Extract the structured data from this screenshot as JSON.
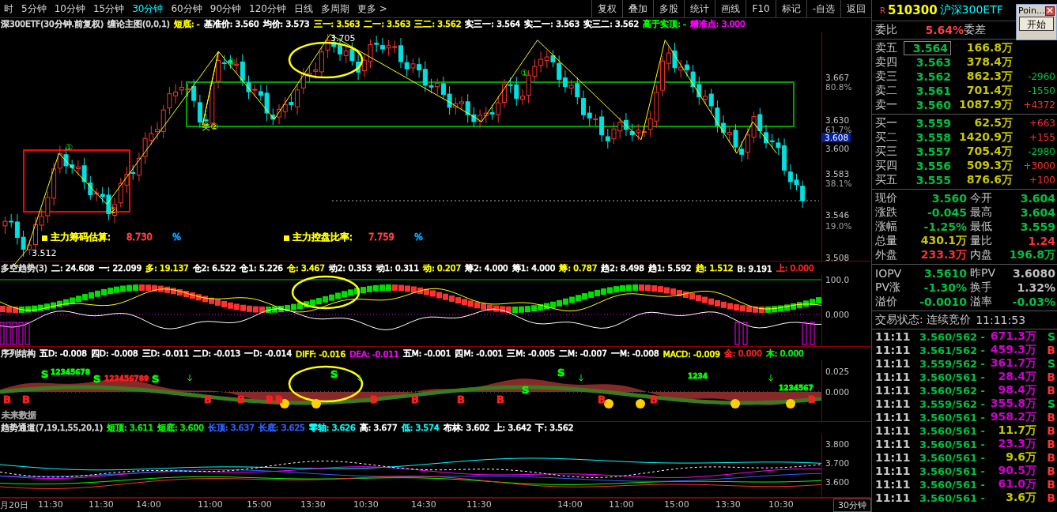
{
  "period_tabs": [
    {
      "label": "时",
      "selected": false
    },
    {
      "label": "5分钟",
      "selected": false
    },
    {
      "label": "10分钟",
      "selected": false
    },
    {
      "label": "15分钟",
      "selected": false
    },
    {
      "label": "30分钟",
      "selected": true
    },
    {
      "label": "60分钟",
      "selected": false
    },
    {
      "label": "90分钟",
      "selected": false
    },
    {
      "label": "120分钟",
      "selected": false
    },
    {
      "label": "日线",
      "selected": false
    },
    {
      "label": "多周期",
      "selected": false
    },
    {
      "label": "更多 >",
      "selected": false
    }
  ],
  "toolbar_buttons": [
    "复权",
    "叠加",
    "多股",
    "统计",
    "画线",
    "F10",
    "标记",
    "-自选",
    "返回"
  ],
  "main_chart": {
    "title": "深300ETF(30分钟.前复权)",
    "indicator": "缠论主图(0,0,1)",
    "readouts": [
      {
        "text": "短底: -",
        "color": "#ffff00"
      },
      {
        "text": "基准价: 3.560",
        "color": "#ffffff"
      },
      {
        "text": "均价: 3.573",
        "color": "#ffffff"
      },
      {
        "text": "三一: 3.563",
        "color": "#ffff00"
      },
      {
        "text": "二一: 3.563",
        "color": "#ffff00"
      },
      {
        "text": "三二: 3.562",
        "color": "#ffff00"
      },
      {
        "text": "实三一: 3.564",
        "color": "#ffffff"
      },
      {
        "text": "实二一: 3.563",
        "color": "#ffffff"
      },
      {
        "text": "实三二: 3.562",
        "color": "#ffffff"
      },
      {
        "text": "高于实顶: -",
        "color": "#00ff00"
      },
      {
        "text": "精准点: 3.000",
        "color": "#ff00ff"
      }
    ],
    "price_labels": [
      {
        "text": "3.667",
        "kind": "price"
      },
      {
        "text": "80.8%",
        "kind": "percent"
      },
      {
        "text": "3.630",
        "kind": "price"
      },
      {
        "text": "61.7%",
        "kind": "percent"
      },
      {
        "text": "3.608",
        "kind": "current"
      },
      {
        "text": "3.600",
        "kind": "price"
      },
      {
        "text": "3.583",
        "kind": "price"
      },
      {
        "text": "38.1%",
        "kind": "percent"
      },
      {
        "text": "3.546",
        "kind": "price"
      },
      {
        "text": "19.0%",
        "kind": "percent"
      },
      {
        "text": "3.508",
        "kind": "price"
      }
    ],
    "marks": [
      {
        "text": "3.705"
      },
      {
        "text": "3.512"
      },
      {
        "text": "①"
      },
      {
        "text": "②"
      },
      {
        "text": "①"
      },
      {
        "text": "类②"
      },
      {
        "text": "①"
      }
    ],
    "stats": [
      {
        "label": "主力筹码估算:",
        "value": "8.730",
        "unit": "%"
      },
      {
        "label": "主力控盘比率:",
        "value": "7.759",
        "unit": "%"
      }
    ]
  },
  "trend_panel": {
    "title": "多空趋势(3)",
    "readouts": [
      {
        "text": "二: 24.608",
        "color": "#ffffff"
      },
      {
        "text": "一: 22.099",
        "color": "#ffffff"
      },
      {
        "text": "多: 19.137",
        "color": "#ffff00"
      },
      {
        "text": "仓2: 6.522",
        "color": "#ffffff"
      },
      {
        "text": "仓1: 5.226",
        "color": "#ffffff"
      },
      {
        "text": "仓: 3.467",
        "color": "#ffff00"
      },
      {
        "text": "动2: 0.353",
        "color": "#ffffff"
      },
      {
        "text": "动1: 0.311",
        "color": "#ffffff"
      },
      {
        "text": "动: 0.207",
        "color": "#ffff00"
      },
      {
        "text": "筹2: 4.000",
        "color": "#ffffff"
      },
      {
        "text": "筹1: 4.000",
        "color": "#ffffff"
      },
      {
        "text": "筹: 0.787",
        "color": "#ffff00"
      },
      {
        "text": "趋2: 8.498",
        "color": "#ffffff"
      },
      {
        "text": "趋1: 5.592",
        "color": "#ffffff"
      },
      {
        "text": "趋: 1.512",
        "color": "#ffff00"
      },
      {
        "text": "B: 9.191",
        "color": "#ffffff"
      },
      {
        "text": "上: 0.000",
        "color": "#ff2020"
      }
    ],
    "axis_labels": [
      "100.0",
      "0.000"
    ]
  },
  "sequence_panel": {
    "title": "序列结构",
    "readouts": [
      {
        "text": "五D: -0.008",
        "color": "#ffffff"
      },
      {
        "text": "四D: -0.008",
        "color": "#ffffff"
      },
      {
        "text": "三D: -0.011",
        "color": "#ffffff"
      },
      {
        "text": "二D: -0.013",
        "color": "#ffffff"
      },
      {
        "text": "一D: -0.014",
        "color": "#ffffff"
      },
      {
        "text": "DIFF: -0.016",
        "color": "#ffff00"
      },
      {
        "text": "DEA: -0.011",
        "color": "#ff00ff"
      },
      {
        "text": "五M: -0.001",
        "color": "#ffffff"
      },
      {
        "text": "四M: -0.001",
        "color": "#ffffff"
      },
      {
        "text": "三M: -0.005",
        "color": "#ffffff"
      },
      {
        "text": "二M: -0.007",
        "color": "#ffffff"
      },
      {
        "text": "一M: -0.008",
        "color": "#ffffff"
      },
      {
        "text": "MACD: -0.009",
        "color": "#ffff00"
      },
      {
        "text": "金: 0.000",
        "color": "#ff2020"
      },
      {
        "text": "木: 0.000",
        "color": "#00ff00"
      }
    ],
    "signals": [
      {
        "text": "B",
        "color": "#ff2020"
      },
      {
        "text": "B",
        "color": "#ff2020"
      },
      {
        "text": "S",
        "color": "#00ff00"
      },
      {
        "text": "12345678",
        "color": "#00ff00"
      },
      {
        "text": "S",
        "color": "#00ff00"
      },
      {
        "text": "123456789",
        "color": "#ff2020"
      },
      {
        "text": "S",
        "color": "#00ff00"
      },
      {
        "text": "B",
        "color": "#ff2020"
      },
      {
        "text": "B",
        "color": "#ff2020"
      },
      {
        "text": "B",
        "color": "#ff2020"
      },
      {
        "text": "B",
        "color": "#ff2020"
      },
      {
        "text": "S",
        "color": "#00ff00"
      },
      {
        "text": "B",
        "color": "#ff2020"
      },
      {
        "text": "B",
        "color": "#ff2020"
      },
      {
        "text": "B",
        "color": "#ff2020"
      },
      {
        "text": "B",
        "color": "#ff2020"
      },
      {
        "text": "S",
        "color": "#00ff00"
      },
      {
        "text": "S",
        "color": "#00ff00"
      },
      {
        "text": "B",
        "color": "#ff2020"
      },
      {
        "text": "B",
        "color": "#ff2020"
      },
      {
        "text": "1234",
        "color": "#00ff00"
      },
      {
        "text": "1234567",
        "color": "#00ff00"
      },
      {
        "text": "B",
        "color": "#ff2020"
      }
    ],
    "note": "未来数据",
    "axis_labels": [
      "0.025",
      "0.000"
    ]
  },
  "channel_panel": {
    "title": "趋势通道(7,19,1,55,20,1)",
    "readouts": [
      {
        "text": "短顶: 3.611",
        "color": "#00ff00"
      },
      {
        "text": "短底: 3.600",
        "color": "#00ff00"
      },
      {
        "text": "长顶: 3.637",
        "color": "#3060ff"
      },
      {
        "text": "长底: 3.625",
        "color": "#3060ff"
      },
      {
        "text": "零轴: 3.626",
        "color": "#00ffff"
      },
      {
        "text": "高: 3.677",
        "color": "#ffffff"
      },
      {
        "text": "低: 3.574",
        "color": "#00ffff"
      },
      {
        "text": "布林: 3.602",
        "color": "#ffffff"
      },
      {
        "text": "上: 3.642",
        "color": "#ffffff"
      },
      {
        "text": "下: 3.562",
        "color": "#ffffff"
      }
    ],
    "axis_labels": [
      "3.800",
      "3.700",
      "3.600"
    ]
  },
  "time_axis": [
    "月20日",
    "11:30",
    "11:30",
    "14:00",
    "11:00",
    "15:00",
    "13:30",
    "10:30",
    "14:30",
    "11:30",
    "14:00",
    "11:00",
    "15:00",
    "13:30",
    "10:30"
  ],
  "period_button": "30分钟",
  "quote": {
    "flag": "R",
    "code": "510300",
    "name": "沪深300ETF",
    "popup": {
      "title": "Poin...",
      "button": "开始"
    },
    "ratio": {
      "label": "委比",
      "value": "5.64%",
      "label2": "委差"
    },
    "asks": [
      {
        "label": "卖五",
        "price": "3.564",
        "volume": "166.8万"
      },
      {
        "label": "卖四",
        "price": "3.563",
        "volume": "378.4万"
      },
      {
        "label": "卖三",
        "price": "3.562",
        "volume": "862.3万",
        "change": {
          "text": "-2960",
          "color": "#00c040"
        }
      },
      {
        "label": "卖二",
        "price": "3.561",
        "volume": "701.4万",
        "change": {
          "text": "-1550",
          "color": "#00c040"
        }
      },
      {
        "label": "卖一",
        "price": "3.560",
        "volume": "1087.9万",
        "change": {
          "text": "+4372",
          "color": "#ff3030"
        }
      }
    ],
    "bids": [
      {
        "label": "买一",
        "price": "3.559",
        "volume": "62.5万",
        "change": {
          "text": "+663",
          "color": "#ff3030"
        }
      },
      {
        "label": "买二",
        "price": "3.558",
        "volume": "1420.9万",
        "change": {
          "text": "+155",
          "color": "#ff3030"
        }
      },
      {
        "label": "买三",
        "price": "3.557",
        "volume": "705.4万",
        "change": {
          "text": "-2980",
          "color": "#00c040"
        }
      },
      {
        "label": "买四",
        "price": "3.556",
        "volume": "509.3万",
        "change": {
          "text": "+3000",
          "color": "#ff3030"
        }
      },
      {
        "label": "买五",
        "price": "3.555",
        "volume": "876.6万",
        "change": {
          "text": "+100",
          "color": "#ff3030"
        }
      }
    ],
    "stats": [
      {
        "left": {
          "label": "现价",
          "value": "3.560",
          "color": "#00c040"
        },
        "right": {
          "label": "今开",
          "value": "3.604",
          "color": "#00c040"
        }
      },
      {
        "left": {
          "label": "涨跌",
          "value": "-0.045",
          "color": "#00c040"
        },
        "right": {
          "label": "最高",
          "value": "3.604",
          "color": "#00c040"
        }
      },
      {
        "left": {
          "label": "涨幅",
          "value": "-1.25%",
          "color": "#00c040"
        },
        "right": {
          "label": "最低",
          "value": "3.559",
          "color": "#00c040"
        }
      },
      {
        "left": {
          "label": "总量",
          "value": "430.1万",
          "color": "#c8c800"
        },
        "right": {
          "label": "量比",
          "value": "1.24",
          "color": "#ff3030"
        }
      },
      {
        "left": {
          "label": "外盘",
          "value": "233.3万",
          "color": "#ff3030"
        },
        "right": {
          "label": "内盘",
          "value": "196.8万",
          "color": "#00c040"
        }
      }
    ],
    "iopv": [
      {
        "left": {
          "label": "IOPV",
          "value": "3.5610",
          "color": "#00c040"
        },
        "right": {
          "label": "昨PV",
          "value": "3.6080",
          "color": "#c0c0c0"
        }
      },
      {
        "left": {
          "label": "PV涨",
          "value": "-1.30%",
          "color": "#00c040"
        },
        "right": {
          "label": "换手",
          "value": "1.32%",
          "color": "#c0c0c0"
        }
      },
      {
        "left": {
          "label": "溢价",
          "value": "-0.0010",
          "color": "#00c040"
        },
        "right": {
          "label": "溢率",
          "value": "-0.03%",
          "color": "#00c040"
        }
      }
    ],
    "status": {
      "label": "交易状态: 连续竞价",
      "time": "11:11:53"
    },
    "trades": [
      {
        "time": "11:11",
        "price": "3.560/562 -",
        "volume": {
          "text": "671.3万",
          "color": "#d000d0"
        },
        "side": {
          "text": "S",
          "color": "#00c040"
        }
      },
      {
        "time": "11:11",
        "price": "3.561/562 -",
        "volume": {
          "text": "459.3万",
          "color": "#d000d0"
        },
        "side": {
          "text": "B",
          "color": "#ff3030"
        }
      },
      {
        "time": "11:11",
        "price": "3.559/562 -",
        "volume": {
          "text": "361.7万",
          "color": "#d000d0"
        },
        "side": {
          "text": "S",
          "color": "#00c040"
        }
      },
      {
        "time": "11:11",
        "price": "3.560/561 -",
        "volume": {
          "text": "28.4万",
          "color": "#d000d0"
        },
        "side": {
          "text": "B",
          "color": "#ff3030"
        }
      },
      {
        "time": "11:11",
        "price": "3.560/562 -",
        "volume": {
          "text": "98.4万",
          "color": "#d000d0"
        },
        "side": {
          "text": "B",
          "color": "#ff3030"
        }
      },
      {
        "time": "11:11",
        "price": "3.559/562 -",
        "volume": {
          "text": "355.8万",
          "color": "#d000d0"
        },
        "side": {
          "text": "S",
          "color": "#00c040"
        }
      },
      {
        "time": "11:11",
        "price": "3.560/561 -",
        "volume": {
          "text": "958.2万",
          "color": "#d000d0"
        },
        "side": {
          "text": "B",
          "color": "#ff3030"
        }
      },
      {
        "time": "11:11",
        "price": "3.560/561 -",
        "volume": {
          "text": "11.7万",
          "color": "#c8c800"
        },
        "side": {
          "text": "B",
          "color": "#ff3030"
        }
      },
      {
        "time": "11:11",
        "price": "3.560/561 -",
        "volume": {
          "text": "23.3万",
          "color": "#d000d0"
        },
        "side": {
          "text": "B",
          "color": "#ff3030"
        }
      },
      {
        "time": "11:11",
        "price": "3.560/561 -",
        "volume": {
          "text": "9.6万",
          "color": "#c8c800"
        },
        "side": {
          "text": "B",
          "color": "#ff3030"
        }
      },
      {
        "time": "11:11",
        "price": "3.560/561 -",
        "volume": {
          "text": "90.5万",
          "color": "#d000d0"
        },
        "side": {
          "text": "B",
          "color": "#ff3030"
        }
      },
      {
        "time": "11:11",
        "price": "3.560/561 -",
        "volume": {
          "text": "61.0万",
          "color": "#d000d0"
        },
        "side": {
          "text": "B",
          "color": "#ff3030"
        }
      },
      {
        "time": "11:11",
        "price": "3.560/561 -",
        "volume": {
          "text": "3.6万",
          "color": "#c8c800"
        },
        "side": {
          "text": "B",
          "color": "#ff3030"
        }
      }
    ]
  }
}
